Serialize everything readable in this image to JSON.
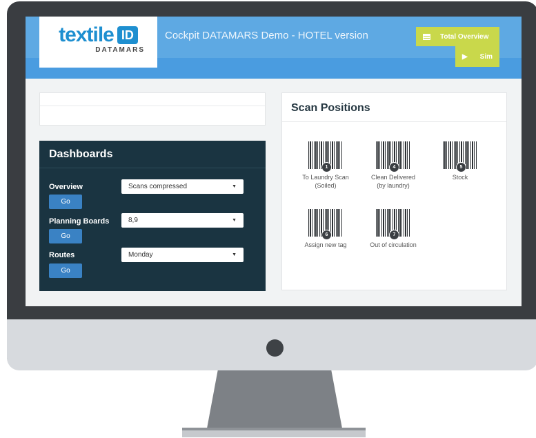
{
  "logo": {
    "word": "textile",
    "badge": "ID",
    "sub": "DATAMARS"
  },
  "app": {
    "title": "Cockpit DATAMARS Demo - HOTEL version"
  },
  "top_buttons": {
    "total_overview": "Total Overview",
    "sim": "Sim"
  },
  "dashboards": {
    "title": "Dashboards",
    "rows": [
      {
        "label": "Overview",
        "selected": "Scans compressed",
        "go": "Go"
      },
      {
        "label": "Planning Boards",
        "selected": "8,9",
        "go": "Go"
      },
      {
        "label": "Routes",
        "selected": "Monday",
        "go": "Go"
      }
    ]
  },
  "scan_positions": {
    "title": "Scan Positions",
    "items": [
      {
        "number": "1",
        "label_line1": "To Laundry Scan",
        "label_line2": "(Soiled)"
      },
      {
        "number": "4",
        "label_line1": "Clean Delivered",
        "label_line2": "(by laundry)"
      },
      {
        "number": "5",
        "label_line1": "Stock",
        "label_line2": ""
      },
      {
        "number": "6",
        "label_line1": "Assign new tag",
        "label_line2": ""
      },
      {
        "number": "7",
        "label_line1": "Out of circulation",
        "label_line2": ""
      }
    ]
  },
  "colors": {
    "header_blue": "#5ea9e3",
    "accent_green": "#c9d84b",
    "dashboard_bg": "#1a3441",
    "go_button": "#3a82c4"
  }
}
